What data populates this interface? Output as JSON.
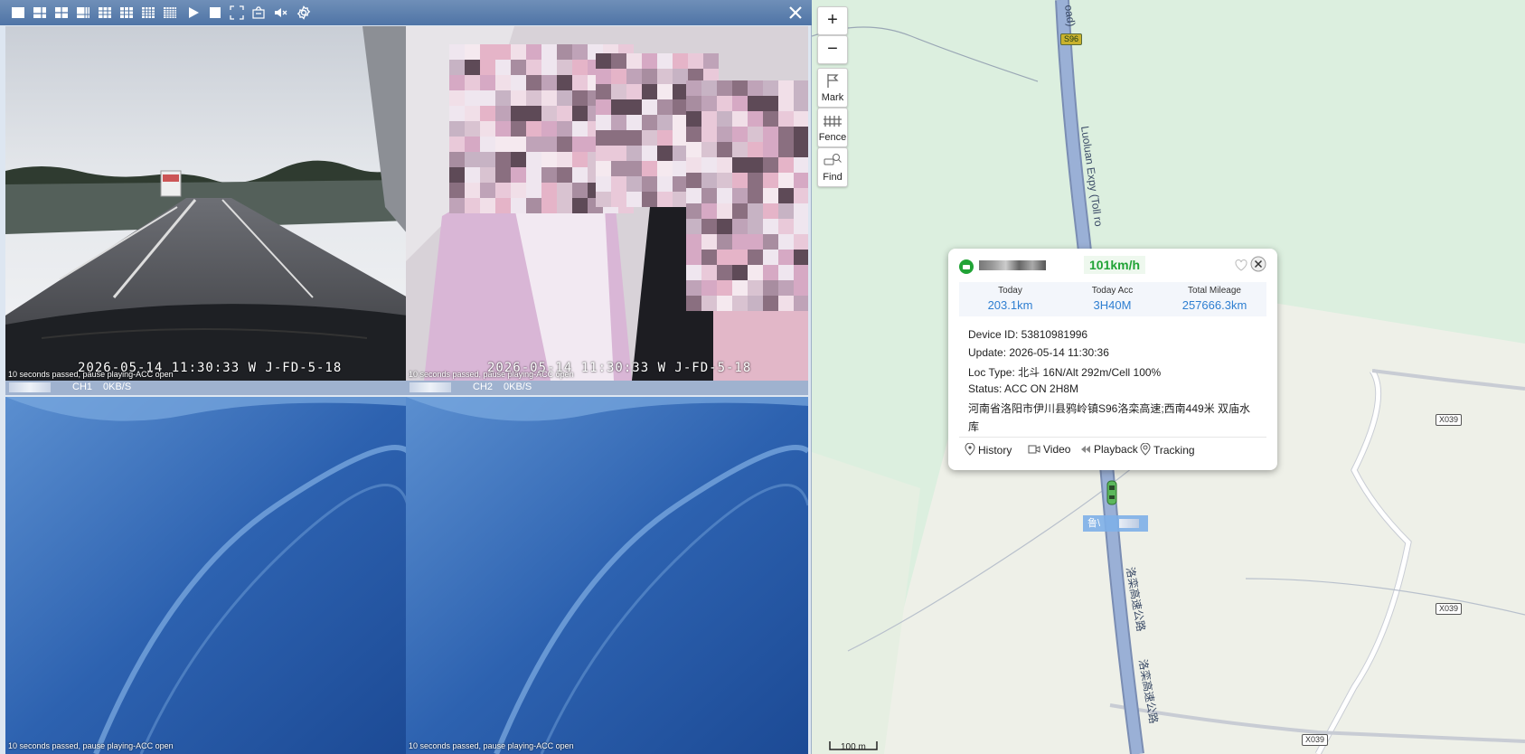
{
  "toolbar": {
    "icons": [
      "layout-1x1-icon",
      "layout-1-plus-5-icon",
      "layout-2x2-icon",
      "layout-1-plus-7-icon",
      "layout-3x3-a-icon",
      "layout-3x3-b-icon",
      "layout-4x4-icon",
      "layout-5x5-icon",
      "play-icon",
      "stop-icon",
      "fullscreen-icon",
      "capture-icon",
      "mute-icon",
      "settings-icon",
      "close-icon"
    ]
  },
  "video": {
    "cells": [
      {
        "osd": "2026-05-14  11:30:33  W J-FD-5-18",
        "status": "10 seconds passed, pause playing-ACC open",
        "channel": "CH1",
        "rate": "0KB/S"
      },
      {
        "osd": "2026-05-14  11:30:33  W J-FD-5-18",
        "status": "10 seconds passed, pause playing-ACC open",
        "channel": "CH2",
        "rate": "0KB/S"
      },
      {
        "status": "10 seconds passed, pause playing-ACC open"
      },
      {
        "status": "10 seconds passed, pause playing-ACC open"
      }
    ]
  },
  "map_controls": {
    "zoom_in": "+",
    "zoom_out": "−",
    "mark": "Mark",
    "fence": "Fence",
    "find": "Find"
  },
  "map": {
    "road_top": "oad)",
    "expressway_label": "Luoluan Expy (Toll ro",
    "s96_shield": "S96",
    "x039_labels": [
      "X039",
      "X039",
      "X039"
    ],
    "chinese_road_label_1": "洛栾高速公路",
    "chinese_road_label_2": "洛栾高速公路",
    "vehicle_tag": "鲁\\",
    "scale": "100 m"
  },
  "popup": {
    "speed": "101km/h",
    "stats": [
      {
        "label": "Today",
        "value": "203.1km"
      },
      {
        "label": "Today Acc",
        "value": "3H40M"
      },
      {
        "label": "Total Mileage",
        "value": "257666.3km"
      }
    ],
    "device_id": "Device ID: 53810981996",
    "update": "Update: 2026-05-14 11:30:36",
    "loc_type": "Loc Type: 北斗 16N/Alt 292m/Cell 100%",
    "status": "Status: ACC ON 2H8M",
    "address_line1": "河南省洛阳市伊川县鸦岭镇S96洛栾高速;西南449米 双庙水",
    "address_line2": "库",
    "actions": {
      "history": "History",
      "video": "Video",
      "playback": "Playback",
      "tracking": "Tracking"
    }
  },
  "colors": {
    "accent": "#2f7fd1",
    "speed_green": "#21a336",
    "toolbar_blue": "#4f74a6",
    "road": "#8ea3c6"
  }
}
